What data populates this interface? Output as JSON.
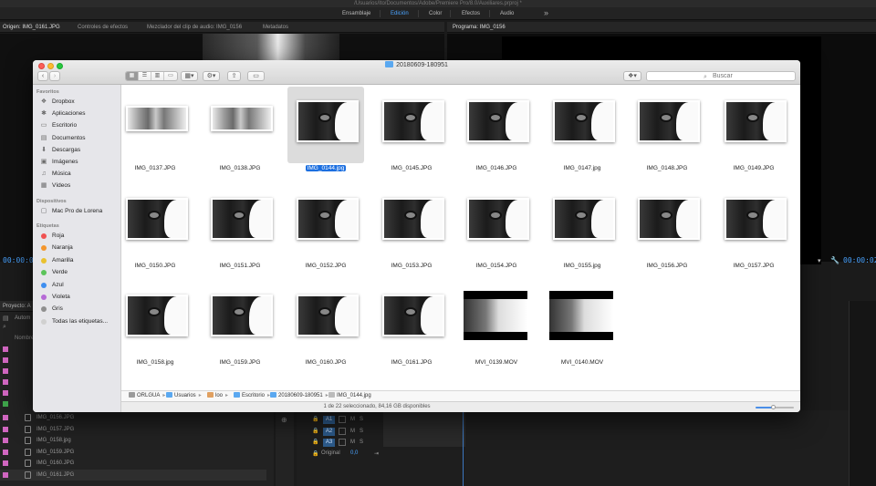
{
  "premiere": {
    "title_path": "/Usuarios/Ito/Documentos/Adobe/Premiere Pro/8.0/Auxiliares.prproj *",
    "workspaces": [
      "Ensamblaje",
      "Edición",
      "Color",
      "Efectos",
      "Audio"
    ],
    "active_workspace": "Edición",
    "source_tabs": [
      "Origen: IMG_0161.JPG",
      "Controles de efectos",
      "Mezclador del clip de audio: IMG_0156",
      "Metadatos"
    ],
    "program_tab": "Programa: IMG_0156",
    "source_timecode": "00:00:0",
    "program_timecode": "00:00:02:",
    "project_tab": "Proyecto: A",
    "project_bin_label": "Autom",
    "project_col_name": "Nombre",
    "project_files": [
      "IMG_0156.JPG",
      "IMG_0157.JPG",
      "IMG_0158.jpg",
      "IMG_0159.JPG",
      "IMG_0160.JPG",
      "IMG_0161.JPG"
    ],
    "project_file_colors": [
      "#d066c0",
      "#d066c0",
      "#d066c0",
      "#d066c0",
      "#d066c0",
      "#d066c0"
    ],
    "audio_tracks": [
      "A1",
      "A2",
      "A3"
    ],
    "audio_track_mute": "M",
    "audio_track_solo": "S",
    "master_label": "Original",
    "master_value": "0,0"
  },
  "finder": {
    "title": "20180609-180951",
    "search_placeholder": "Buscar",
    "sidebar": {
      "favorites_header": "Favoritos",
      "favorites": [
        {
          "label": "Dropbox",
          "icon": "dropbox-icon",
          "glyph": "❖"
        },
        {
          "label": "Aplicaciones",
          "icon": "applications-icon",
          "glyph": "✱"
        },
        {
          "label": "Escritorio",
          "icon": "desktop-icon",
          "glyph": "▭"
        },
        {
          "label": "Documentos",
          "icon": "documents-icon",
          "glyph": "▤"
        },
        {
          "label": "Descargas",
          "icon": "downloads-icon",
          "glyph": "⬇"
        },
        {
          "label": "Imágenes",
          "icon": "pictures-icon",
          "glyph": "▣"
        },
        {
          "label": "Música",
          "icon": "music-icon",
          "glyph": "♫"
        },
        {
          "label": "Vídeos",
          "icon": "movies-icon",
          "glyph": "▦"
        }
      ],
      "devices_header": "Dispositivos",
      "devices": [
        {
          "label": "Mac Pro de Lorena",
          "icon": "computer-icon",
          "glyph": "▢"
        }
      ],
      "tags_header": "Etiquetas",
      "tags": [
        {
          "label": "Roja",
          "color": "#f05252"
        },
        {
          "label": "Naranja",
          "color": "#f4962c"
        },
        {
          "label": "Amarilla",
          "color": "#e9c12f"
        },
        {
          "label": "Verde",
          "color": "#5cc45a"
        },
        {
          "label": "Azul",
          "color": "#3e8ef0"
        },
        {
          "label": "Violeta",
          "color": "#b66ad6"
        },
        {
          "label": "Gris",
          "color": "#8f8f8f"
        },
        {
          "label": "Todas las etiquetas...",
          "color": "#d0d0d0"
        }
      ]
    },
    "files": [
      {
        "name": "IMG_0137.JPG",
        "kind": "face"
      },
      {
        "name": "IMG_0138.JPG",
        "kind": "face"
      },
      {
        "name": "IMG_0144.jpg",
        "kind": "dark",
        "selected": true
      },
      {
        "name": "IMG_0145.JPG",
        "kind": "dark"
      },
      {
        "name": "IMG_0146.JPG",
        "kind": "dark"
      },
      {
        "name": "IMG_0147.jpg",
        "kind": "dark"
      },
      {
        "name": "IMG_0148.JPG",
        "kind": "dark"
      },
      {
        "name": "IMG_0149.JPG",
        "kind": "dark"
      },
      {
        "name": "IMG_0150.JPG",
        "kind": "dark"
      },
      {
        "name": "IMG_0151.JPG",
        "kind": "dark"
      },
      {
        "name": "IMG_0152.JPG",
        "kind": "dark"
      },
      {
        "name": "IMG_0153.JPG",
        "kind": "dark"
      },
      {
        "name": "IMG_0154.JPG",
        "kind": "dark"
      },
      {
        "name": "IMG_0155.jpg",
        "kind": "dark"
      },
      {
        "name": "IMG_0156.JPG",
        "kind": "dark"
      },
      {
        "name": "IMG_0157.JPG",
        "kind": "dark"
      },
      {
        "name": "IMG_0158.jpg",
        "kind": "dark"
      },
      {
        "name": "IMG_0159.JPG",
        "kind": "dark"
      },
      {
        "name": "IMG_0160.JPG",
        "kind": "dark"
      },
      {
        "name": "IMG_0161.JPG",
        "kind": "dark"
      },
      {
        "name": "MVI_0139.MOV",
        "kind": "mov"
      },
      {
        "name": "MVI_0140.MOV",
        "kind": "mov"
      }
    ],
    "path": [
      "ORLGUA",
      "Usuarios",
      "loo",
      "Escritorio",
      "20180609-180951",
      "IMG_0144.jpg"
    ],
    "path_sep": "▸",
    "status": "1 de 22 seleccionado, 84,16 GB disponibles",
    "icon_zoom_fraction": 0.45
  }
}
